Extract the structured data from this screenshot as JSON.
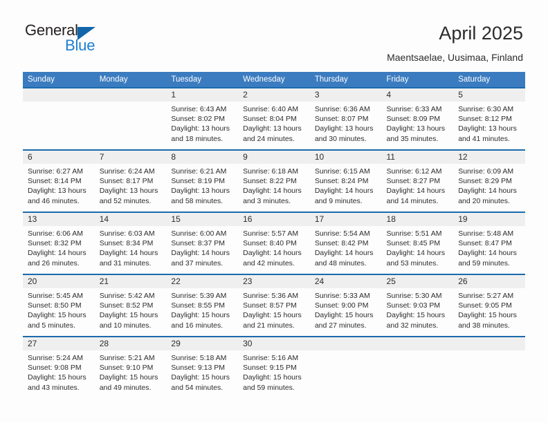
{
  "brand": {
    "line1": "General",
    "line2": "Blue",
    "triangle_color": "#1166ab"
  },
  "header": {
    "title": "April 2025",
    "subtitle": "Maentsaelae, Uusimaa, Finland"
  },
  "theme": {
    "header_blue": "#3b7cc0",
    "row_divider_blue": "#1a6aad",
    "daynum_band": "#efefef",
    "page_bg": "#fdfdfd"
  },
  "weekdays": [
    "Sunday",
    "Monday",
    "Tuesday",
    "Wednesday",
    "Thursday",
    "Friday",
    "Saturday"
  ],
  "weeks": [
    [
      {
        "day": "",
        "lines": []
      },
      {
        "day": "",
        "lines": []
      },
      {
        "day": "1",
        "lines": [
          "Sunrise: 6:43 AM",
          "Sunset: 8:02 PM",
          "Daylight: 13 hours",
          "and 18 minutes."
        ]
      },
      {
        "day": "2",
        "lines": [
          "Sunrise: 6:40 AM",
          "Sunset: 8:04 PM",
          "Daylight: 13 hours",
          "and 24 minutes."
        ]
      },
      {
        "day": "3",
        "lines": [
          "Sunrise: 6:36 AM",
          "Sunset: 8:07 PM",
          "Daylight: 13 hours",
          "and 30 minutes."
        ]
      },
      {
        "day": "4",
        "lines": [
          "Sunrise: 6:33 AM",
          "Sunset: 8:09 PM",
          "Daylight: 13 hours",
          "and 35 minutes."
        ]
      },
      {
        "day": "5",
        "lines": [
          "Sunrise: 6:30 AM",
          "Sunset: 8:12 PM",
          "Daylight: 13 hours",
          "and 41 minutes."
        ]
      }
    ],
    [
      {
        "day": "6",
        "lines": [
          "Sunrise: 6:27 AM",
          "Sunset: 8:14 PM",
          "Daylight: 13 hours",
          "and 46 minutes."
        ]
      },
      {
        "day": "7",
        "lines": [
          "Sunrise: 6:24 AM",
          "Sunset: 8:17 PM",
          "Daylight: 13 hours",
          "and 52 minutes."
        ]
      },
      {
        "day": "8",
        "lines": [
          "Sunrise: 6:21 AM",
          "Sunset: 8:19 PM",
          "Daylight: 13 hours",
          "and 58 minutes."
        ]
      },
      {
        "day": "9",
        "lines": [
          "Sunrise: 6:18 AM",
          "Sunset: 8:22 PM",
          "Daylight: 14 hours",
          "and 3 minutes."
        ]
      },
      {
        "day": "10",
        "lines": [
          "Sunrise: 6:15 AM",
          "Sunset: 8:24 PM",
          "Daylight: 14 hours",
          "and 9 minutes."
        ]
      },
      {
        "day": "11",
        "lines": [
          "Sunrise: 6:12 AM",
          "Sunset: 8:27 PM",
          "Daylight: 14 hours",
          "and 14 minutes."
        ]
      },
      {
        "day": "12",
        "lines": [
          "Sunrise: 6:09 AM",
          "Sunset: 8:29 PM",
          "Daylight: 14 hours",
          "and 20 minutes."
        ]
      }
    ],
    [
      {
        "day": "13",
        "lines": [
          "Sunrise: 6:06 AM",
          "Sunset: 8:32 PM",
          "Daylight: 14 hours",
          "and 26 minutes."
        ]
      },
      {
        "day": "14",
        "lines": [
          "Sunrise: 6:03 AM",
          "Sunset: 8:34 PM",
          "Daylight: 14 hours",
          "and 31 minutes."
        ]
      },
      {
        "day": "15",
        "lines": [
          "Sunrise: 6:00 AM",
          "Sunset: 8:37 PM",
          "Daylight: 14 hours",
          "and 37 minutes."
        ]
      },
      {
        "day": "16",
        "lines": [
          "Sunrise: 5:57 AM",
          "Sunset: 8:40 PM",
          "Daylight: 14 hours",
          "and 42 minutes."
        ]
      },
      {
        "day": "17",
        "lines": [
          "Sunrise: 5:54 AM",
          "Sunset: 8:42 PM",
          "Daylight: 14 hours",
          "and 48 minutes."
        ]
      },
      {
        "day": "18",
        "lines": [
          "Sunrise: 5:51 AM",
          "Sunset: 8:45 PM",
          "Daylight: 14 hours",
          "and 53 minutes."
        ]
      },
      {
        "day": "19",
        "lines": [
          "Sunrise: 5:48 AM",
          "Sunset: 8:47 PM",
          "Daylight: 14 hours",
          "and 59 minutes."
        ]
      }
    ],
    [
      {
        "day": "20",
        "lines": [
          "Sunrise: 5:45 AM",
          "Sunset: 8:50 PM",
          "Daylight: 15 hours",
          "and 5 minutes."
        ]
      },
      {
        "day": "21",
        "lines": [
          "Sunrise: 5:42 AM",
          "Sunset: 8:52 PM",
          "Daylight: 15 hours",
          "and 10 minutes."
        ]
      },
      {
        "day": "22",
        "lines": [
          "Sunrise: 5:39 AM",
          "Sunset: 8:55 PM",
          "Daylight: 15 hours",
          "and 16 minutes."
        ]
      },
      {
        "day": "23",
        "lines": [
          "Sunrise: 5:36 AM",
          "Sunset: 8:57 PM",
          "Daylight: 15 hours",
          "and 21 minutes."
        ]
      },
      {
        "day": "24",
        "lines": [
          "Sunrise: 5:33 AM",
          "Sunset: 9:00 PM",
          "Daylight: 15 hours",
          "and 27 minutes."
        ]
      },
      {
        "day": "25",
        "lines": [
          "Sunrise: 5:30 AM",
          "Sunset: 9:03 PM",
          "Daylight: 15 hours",
          "and 32 minutes."
        ]
      },
      {
        "day": "26",
        "lines": [
          "Sunrise: 5:27 AM",
          "Sunset: 9:05 PM",
          "Daylight: 15 hours",
          "and 38 minutes."
        ]
      }
    ],
    [
      {
        "day": "27",
        "lines": [
          "Sunrise: 5:24 AM",
          "Sunset: 9:08 PM",
          "Daylight: 15 hours",
          "and 43 minutes."
        ]
      },
      {
        "day": "28",
        "lines": [
          "Sunrise: 5:21 AM",
          "Sunset: 9:10 PM",
          "Daylight: 15 hours",
          "and 49 minutes."
        ]
      },
      {
        "day": "29",
        "lines": [
          "Sunrise: 5:18 AM",
          "Sunset: 9:13 PM",
          "Daylight: 15 hours",
          "and 54 minutes."
        ]
      },
      {
        "day": "30",
        "lines": [
          "Sunrise: 5:16 AM",
          "Sunset: 9:15 PM",
          "Daylight: 15 hours",
          "and 59 minutes."
        ]
      },
      {
        "day": "",
        "lines": []
      },
      {
        "day": "",
        "lines": []
      },
      {
        "day": "",
        "lines": []
      }
    ]
  ]
}
